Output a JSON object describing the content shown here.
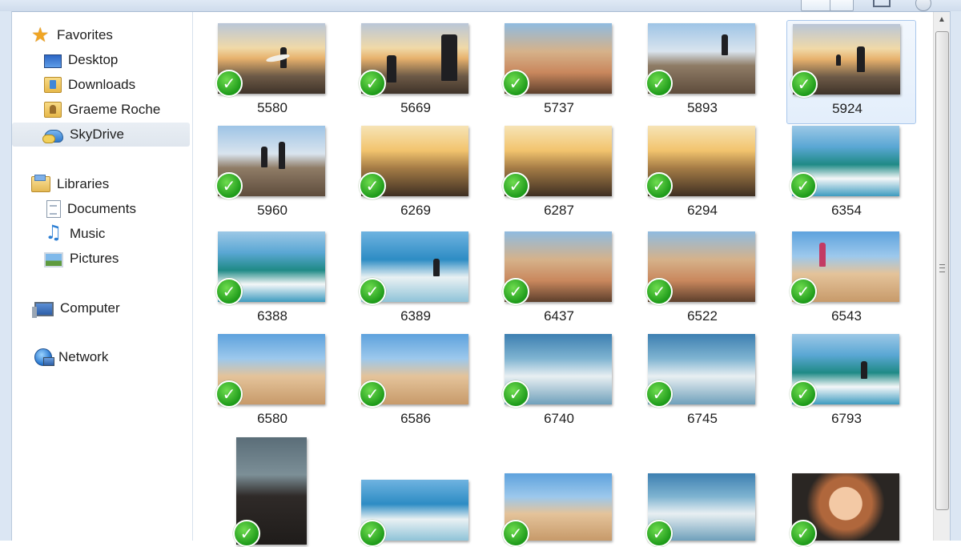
{
  "nav": {
    "favorites": {
      "label": "Favorites",
      "icon": "star-icon"
    },
    "favorite_items": [
      {
        "label": "Desktop",
        "icon": "desktop-icon"
      },
      {
        "label": "Downloads",
        "icon": "downloads-folder-icon"
      },
      {
        "label": "Graeme Roche",
        "icon": "user-folder-icon"
      },
      {
        "label": "SkyDrive",
        "icon": "skydrive-icon",
        "selected": true
      }
    ],
    "libraries": {
      "label": "Libraries",
      "icon": "libraries-icon"
    },
    "library_items": [
      {
        "label": "Documents",
        "icon": "documents-icon"
      },
      {
        "label": "Music",
        "icon": "music-icon"
      },
      {
        "label": "Pictures",
        "icon": "pictures-icon"
      }
    ],
    "computer": {
      "label": "Computer",
      "icon": "computer-icon"
    },
    "network": {
      "label": "Network",
      "icon": "network-icon"
    }
  },
  "files": [
    {
      "name": "5580",
      "synced": true
    },
    {
      "name": "5669",
      "synced": true
    },
    {
      "name": "5737",
      "synced": true
    },
    {
      "name": "5893",
      "synced": true
    },
    {
      "name": "5924",
      "synced": true,
      "selected": true
    },
    {
      "name": "5960",
      "synced": true
    },
    {
      "name": "6269",
      "synced": true
    },
    {
      "name": "6287",
      "synced": true
    },
    {
      "name": "6294",
      "synced": true
    },
    {
      "name": "6354",
      "synced": true
    },
    {
      "name": "6388",
      "synced": true
    },
    {
      "name": "6389",
      "synced": true
    },
    {
      "name": "6437",
      "synced": true
    },
    {
      "name": "6522",
      "synced": true
    },
    {
      "name": "6543",
      "synced": true
    },
    {
      "name": "6580",
      "synced": true
    },
    {
      "name": "6586",
      "synced": true
    },
    {
      "name": "6740",
      "synced": true
    },
    {
      "name": "6745",
      "synced": true
    },
    {
      "name": "6793",
      "synced": true
    }
  ],
  "check_glyph": "✓",
  "scroll_up_glyph": "▲",
  "colors": {
    "sync_check": "#1e9b1a",
    "selection": "#a9c7ec",
    "nav_selected": "#dfe6ee"
  }
}
